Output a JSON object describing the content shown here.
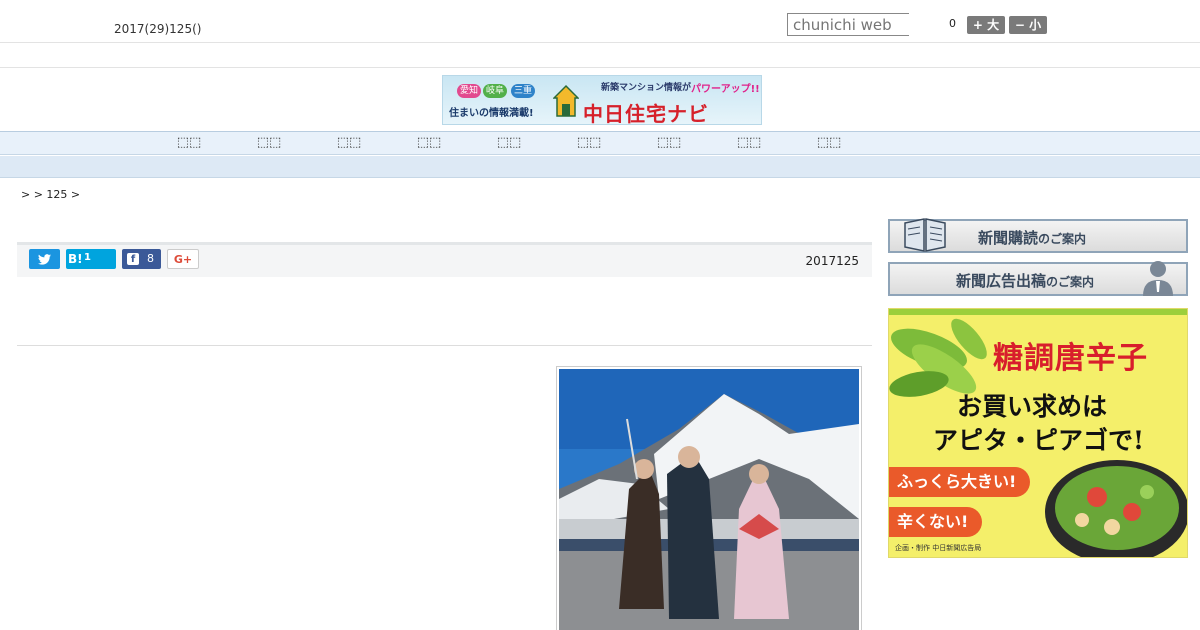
{
  "header": {
    "date": "2017(29)125()",
    "search_placeholder": "chunichi web",
    "font_size_value": "0",
    "font_large_label": "+ 大",
    "font_small_label": "− 小"
  },
  "banner": {
    "prefectures": [
      "愛知",
      "岐阜",
      "三重"
    ],
    "tagline": "新築マンション情報が",
    "power_up": "パワーアップ!!",
    "subtitle": "住まいの情報満載!",
    "title": "中日住宅ナビ"
  },
  "nav": {
    "items": [
      "⬚⬚",
      "⬚⬚",
      "⬚⬚",
      "⬚⬚",
      "⬚⬚",
      "⬚⬚",
      "⬚⬚",
      "⬚⬚",
      "⬚⬚"
    ]
  },
  "breadcrumb": ">  > 125 >",
  "share": {
    "hatena_label": "B!",
    "hatena_count": "1",
    "facebook_count": "8",
    "gplus_label": "G+"
  },
  "article": {
    "date": "2017125"
  },
  "sidebar": {
    "subscribe_main": "新聞購読",
    "subscribe_suffix": "のご案内",
    "advertise_main": "新聞広告出稿",
    "advertise_suffix": "のご案内"
  },
  "ad": {
    "title": "糖調唐辛子",
    "line1": "お買い求めは",
    "line2": "アピタ・ピアゴで!",
    "pill1": "ふっくら大きい!",
    "pill2": "辛くない!",
    "credit": "企画・制作 中日新聞広告局"
  },
  "colors": {
    "nav_bg": "#e8f1fa",
    "twitter": "#1b95e0",
    "hatena": "#00a4de",
    "facebook": "#3b5998",
    "ad_bg": "#f4ef6a",
    "ad_red": "#d81e2c"
  }
}
